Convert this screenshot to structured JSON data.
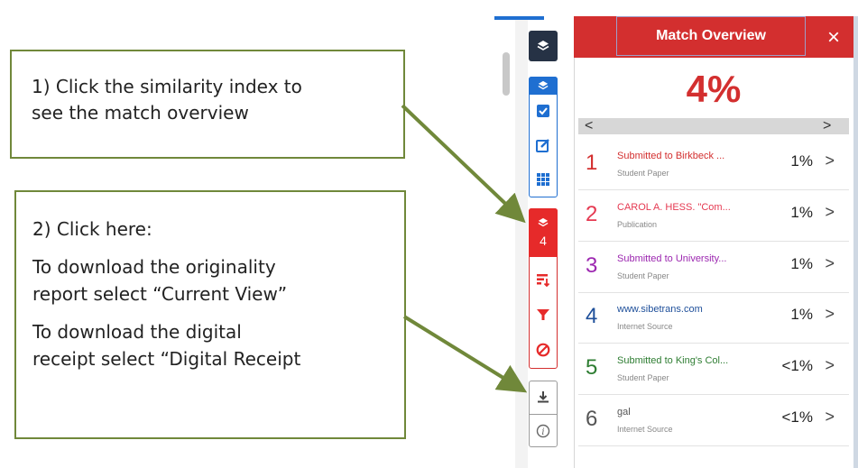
{
  "callouts": {
    "first": {
      "line1": "1) Click the similarity index to",
      "line2": "see the match overview"
    },
    "second": {
      "heading": "2) Click here:",
      "line1": "To download the originality",
      "line2": "report select “Current View”",
      "line3": "To download the digital",
      "line4": "receipt select “Digital Receipt"
    }
  },
  "toolbar": {
    "filter_count": "4",
    "icons": [
      "layers-icon",
      "checkbox-icon",
      "edit-icon",
      "grid-icon",
      "sort-icon",
      "filter-icon",
      "exclude-icon",
      "download-icon",
      "info-icon"
    ]
  },
  "panel": {
    "title": "Match Overview",
    "close": "×",
    "similarity_index": "4%",
    "nav_prev": "<",
    "nav_next": ">",
    "matches": [
      {
        "rank": "1",
        "source": "Submitted to Birkbeck ...",
        "type": "Student Paper",
        "percent": "1%",
        "color": "#d32f2f"
      },
      {
        "rank": "2",
        "source": "CAROL A. HESS. \"Com...",
        "type": "Publication",
        "percent": "1%",
        "color": "#e53951"
      },
      {
        "rank": "3",
        "source": "Submitted to University...",
        "type": "Student Paper",
        "percent": "1%",
        "color": "#9c27b0"
      },
      {
        "rank": "4",
        "source": "www.sibetrans.com",
        "type": "Internet Source",
        "percent": "1%",
        "color": "#1e4f9a"
      },
      {
        "rank": "5",
        "source": "Submitted to King's Col...",
        "type": "Student Paper",
        "percent": "<1%",
        "color": "#2e7d32"
      },
      {
        "rank": "6",
        "source": "gal",
        "type": "Internet Source",
        "percent": "<1%",
        "color": "#555555"
      }
    ],
    "chevron": ">"
  },
  "colors": {
    "accent_red": "#d32f2f",
    "toolbar_blue": "#1f6fd1",
    "arrow_green": "#70883a"
  }
}
